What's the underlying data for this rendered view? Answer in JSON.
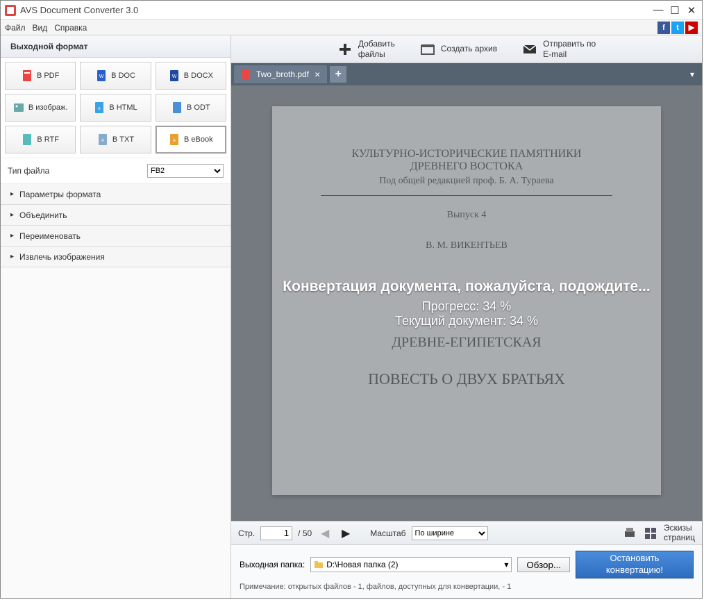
{
  "window": {
    "title": "AVS Document Converter 3.0"
  },
  "menu": {
    "file": "Файл",
    "view": "Вид",
    "help": "Справка"
  },
  "left": {
    "header": "Выходной формат",
    "formats": [
      {
        "label": "В PDF"
      },
      {
        "label": "В DOC"
      },
      {
        "label": "В DOCX"
      },
      {
        "label": "В изображ."
      },
      {
        "label": "В HTML"
      },
      {
        "label": "В ODT"
      },
      {
        "label": "В RTF"
      },
      {
        "label": "В TXT"
      },
      {
        "label": "В eBook"
      }
    ],
    "filetype_label": "Тип файла",
    "filetype_value": "FB2",
    "accordion": [
      "Параметры формата",
      "Объединить",
      "Переименовать",
      "Извлечь изображения"
    ]
  },
  "topbar": {
    "add_files": "Добавить\nфайлы",
    "create_archive": "Создать архив",
    "send_email": "Отправить по\nE-mail"
  },
  "tab": {
    "name": "Two_broth.pdf"
  },
  "doc": {
    "l1": "КУЛЬТУРНО-ИСТОРИЧЕСКИЕ ПАМЯТНИКИ",
    "l2": "ДРЕВНЕГО ВОСТОКА",
    "l3": "Под общей редакцией проф. Б. А. Тураева",
    "issue": "Выпуск 4",
    "author": "В. М. ВИКЕНТЬЕВ",
    "t1": "ДРЕВНЕ-ЕГИПЕТСКАЯ",
    "t2": "ПОВЕСТЬ О ДВУХ БРАТЬЯХ"
  },
  "overlay": {
    "message": "Конвертация документа, пожалуйста, подождите...",
    "progress": "Прогресс: 34 %",
    "current": "Текущий документ: 34 %"
  },
  "nav": {
    "page_label": "Стр.",
    "page_current": "1",
    "page_total": "/ 50",
    "zoom_label": "Масштаб",
    "zoom_value": "По ширине",
    "thumbs": "Эскизы\nстраниц"
  },
  "bottom": {
    "outfolder_label": "Выходная папка:",
    "outfolder_path": "D:\\Новая папка (2)",
    "browse": "Обзор...",
    "stop": "Остановить\nконвертацию!",
    "note": "Примечание: открытых файлов - 1, файлов, доступных для конвертации, - 1"
  }
}
